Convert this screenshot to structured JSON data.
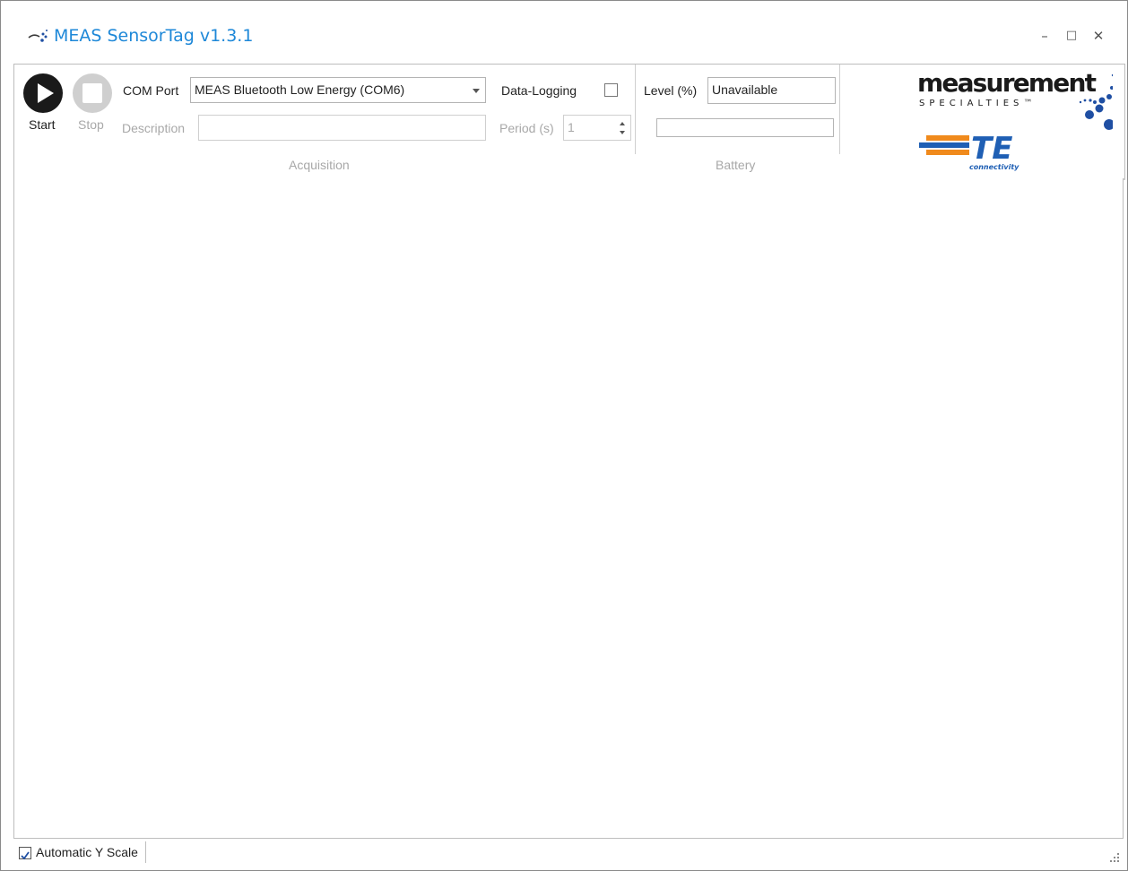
{
  "window": {
    "title": "MEAS SensorTag v1.3.1",
    "controls": {
      "minimize": "–",
      "maximize": "□",
      "close": "✕"
    }
  },
  "ribbon": {
    "acquisition": {
      "group_label": "Acquisition",
      "start_label": "Start",
      "stop_label": "Stop",
      "com_port_label": "COM Port",
      "com_port_value": "MEAS Bluetooth Low Energy (COM6)",
      "description_label": "Description",
      "description_value": "",
      "data_logging_label": "Data-Logging",
      "data_logging_checked": false,
      "period_label": "Period (s)",
      "period_value": "1"
    },
    "battery": {
      "group_label": "Battery",
      "level_label": "Level (%)",
      "level_value": "Unavailable",
      "level_fraction": 0
    },
    "logos": {
      "brand1": "measurement",
      "brand1_sub": "SPECIALTIES™",
      "brand2": "TE",
      "brand2_sub": "connectivity"
    }
  },
  "statusbar": {
    "auto_y_scale_label": "Automatic Y Scale",
    "auto_y_scale_checked": true
  },
  "colors": {
    "title": "#1e88d8",
    "start_button": "#1a1a1a",
    "stop_button": "#cfcfcf",
    "meas_dots": "#1f4fa3",
    "te_orange": "#f08a1c",
    "te_blue": "#1f5fb4"
  },
  "icons": {
    "app": "sensor-tag-icon",
    "start": "play-icon",
    "stop": "stop-icon",
    "combo": "chevron-down-icon",
    "grip": "resize-grip-icon"
  }
}
